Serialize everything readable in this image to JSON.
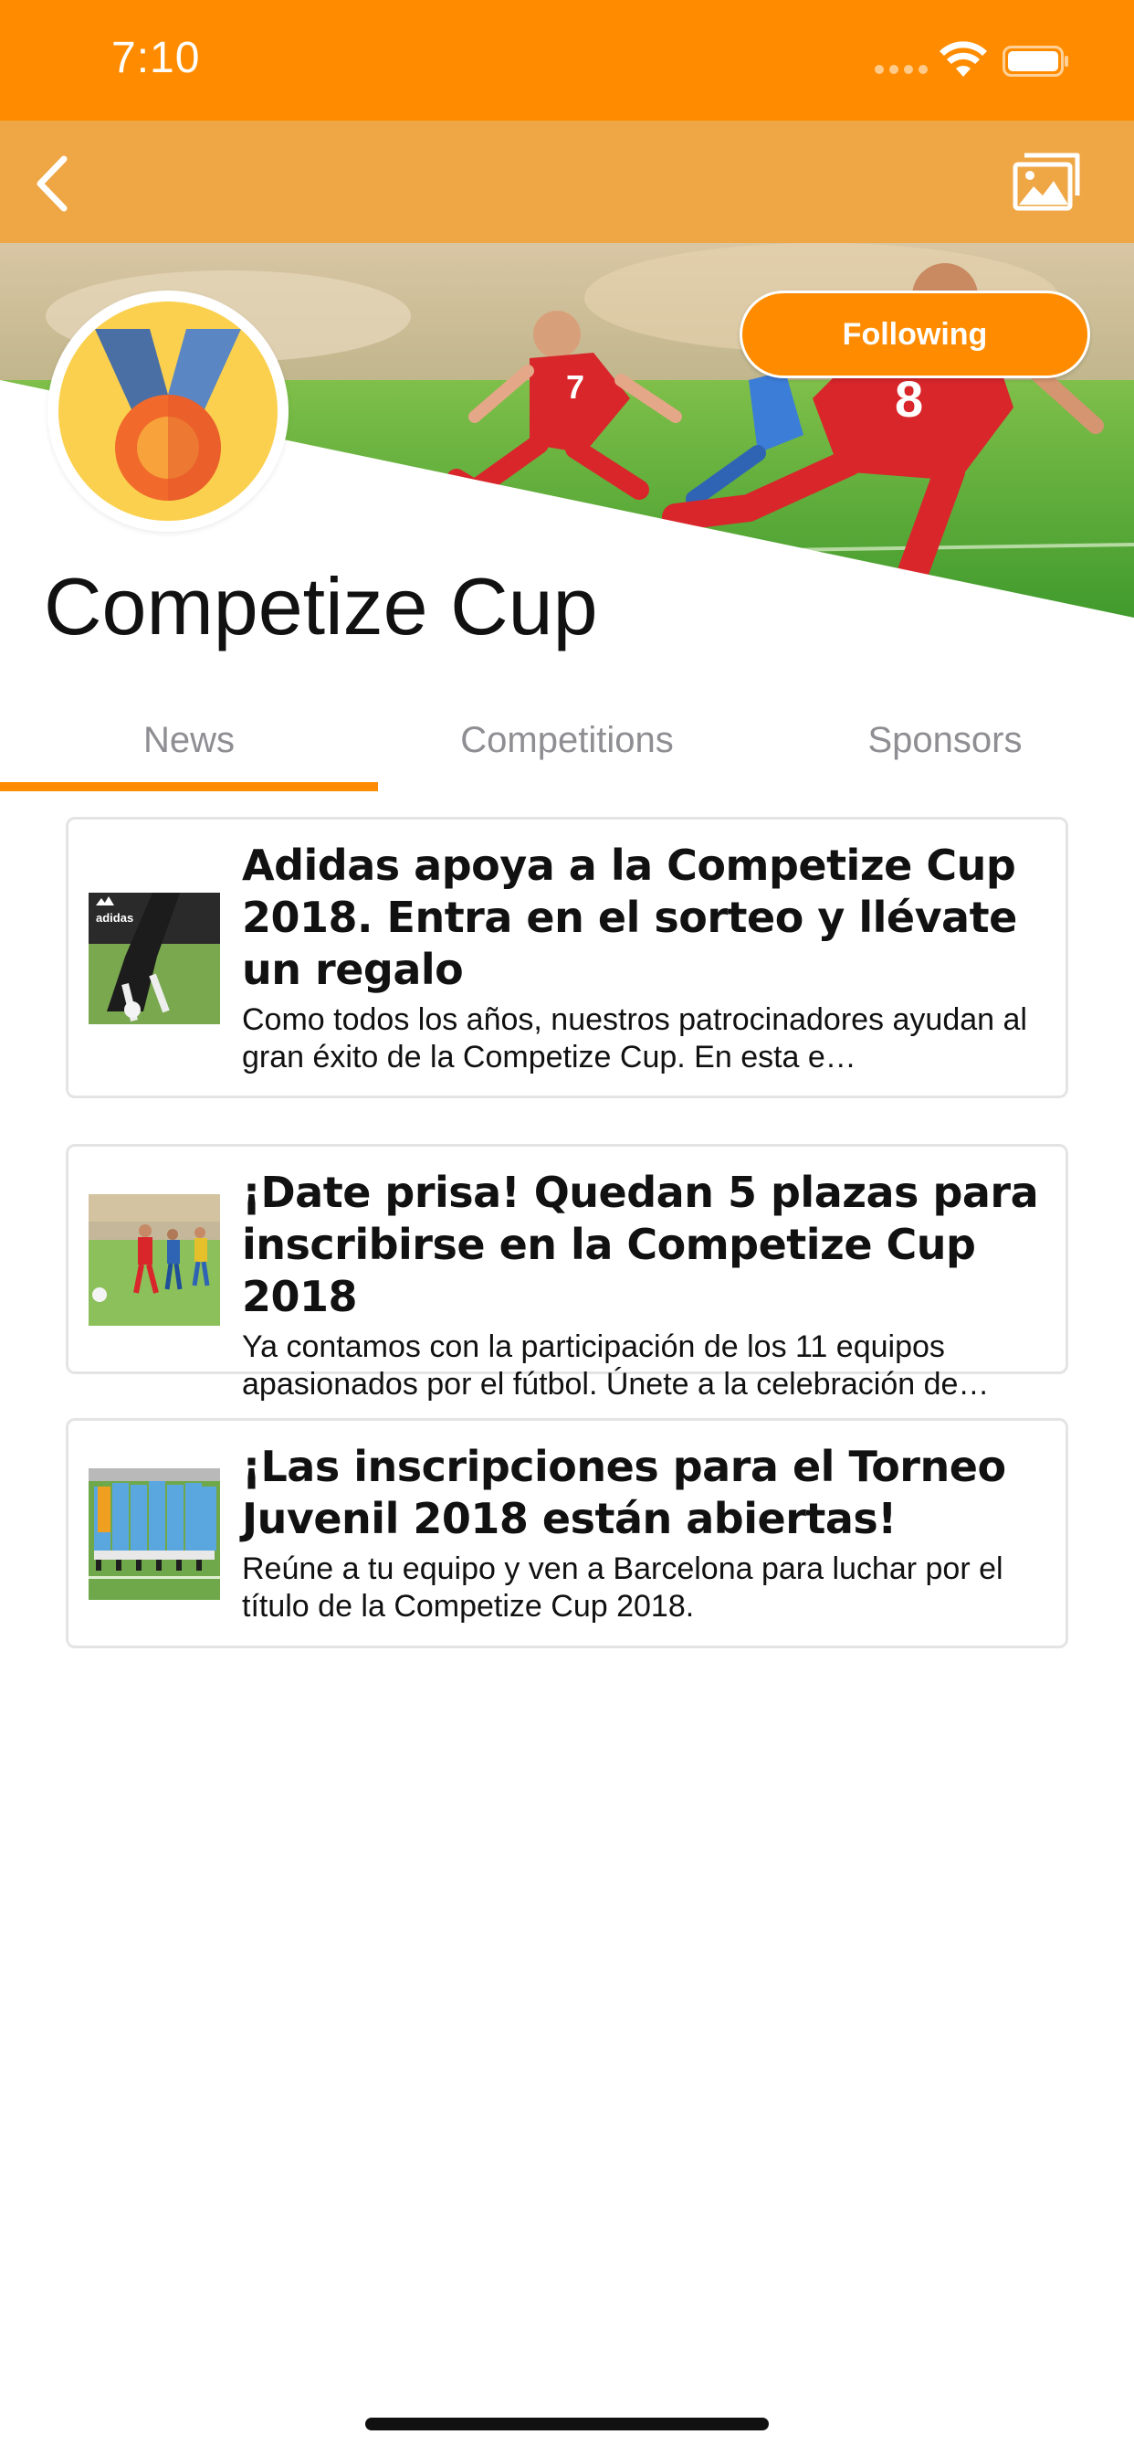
{
  "status_bar": {
    "time": "7:10"
  },
  "nav": {
    "back_icon": "chevron-left-icon",
    "gallery_icon": "photo-gallery-icon"
  },
  "header": {
    "title": "Competize Cup",
    "follow_label": "Following",
    "avatar_icon": "medal-icon"
  },
  "tabs": [
    {
      "label": "News",
      "active": true
    },
    {
      "label": "Competitions",
      "active": false
    },
    {
      "label": "Sponsors",
      "active": false
    }
  ],
  "news": [
    {
      "title": "Adidas apoya a la Competize Cup 2018. Entra en el sorteo y llévate un regalo",
      "summary": "Como todos los años, nuestros patrocinadores ayudan al gran éxito de la Competize Cup. En esta e…",
      "thumb_text": "adidas"
    },
    {
      "title": "¡Date prisa! Quedan 5 plazas para inscribirse en la Competize Cup 2018",
      "summary": "Ya contamos con la participación de los 11 equipos apasionados por el fútbol. Únete a la celebración de…"
    },
    {
      "title": "¡Las inscripciones para el Torneo Juvenil 2018 están abiertas!",
      "summary": "Reúne a tu equipo y ven a Barcelona para luchar por el título de la Competize Cup 2018."
    }
  ],
  "colors": {
    "status_bar": "#FF8C00",
    "nav_bar": "#EFA645",
    "accent": "#FF8C00"
  }
}
